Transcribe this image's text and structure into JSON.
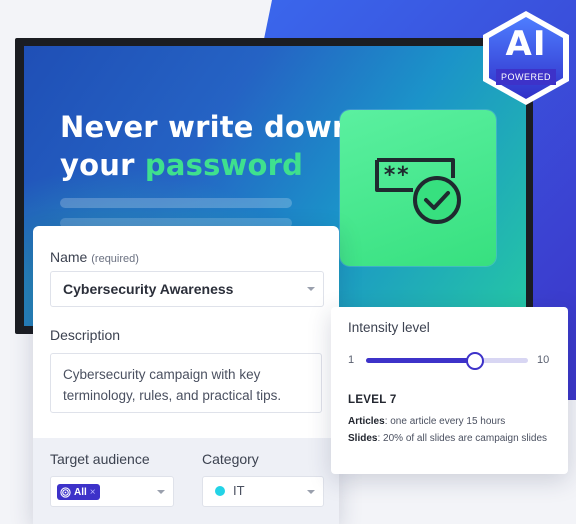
{
  "colors": {
    "accent": "#3d32c9",
    "headline_accent": "#3fe08e",
    "card_green": "#37e07f",
    "category_dot": "#23d3e6"
  },
  "display": {
    "headline_line1": "Never write down",
    "headline_line2_plain": "your",
    "headline_line2_accent": "password",
    "card_icon": "password-check-icon"
  },
  "badge": {
    "main": "AI",
    "sub": "POWERED"
  },
  "form": {
    "name_label": "Name",
    "name_required": "(required)",
    "name_value": "Cybersecurity Awareness",
    "description_label": "Description",
    "description_value": "Cybersecurity campaign with key terminology, rules, and practical tips.",
    "audience_label": "Target audience",
    "audience_chip": "All",
    "audience_chip_icon": "target-icon",
    "audience_chip_remove": "×",
    "category_label": "Category",
    "category_value": "IT"
  },
  "intensity": {
    "title": "Intensity level",
    "min": "1",
    "max": "10",
    "value": 7,
    "level_label": "LEVEL 7",
    "articles_label": "Articles",
    "articles_text": ": one article every 15 hours",
    "slides_label": "Slides",
    "slides_text": ": 20% of all slides are campaign slides"
  }
}
